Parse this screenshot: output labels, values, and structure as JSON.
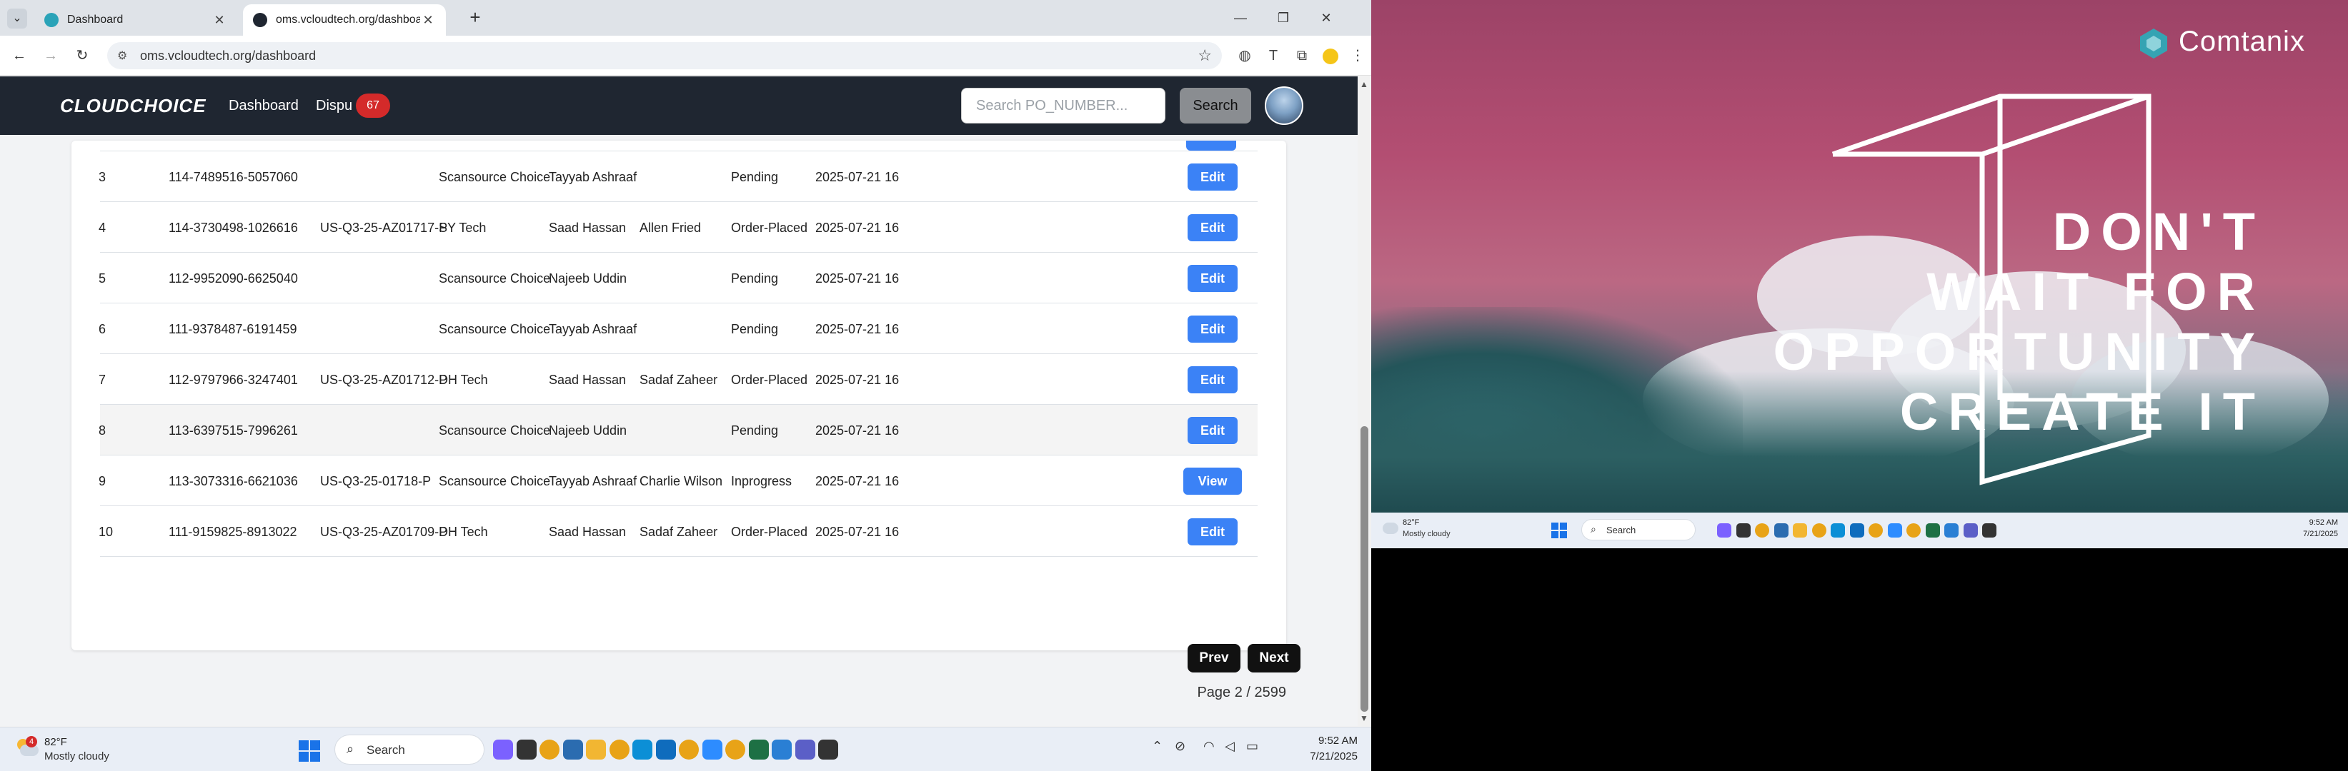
{
  "browser": {
    "tabs": [
      {
        "title": "Dashboard",
        "favicon_color": "#2aa3b8"
      },
      {
        "title": "oms.vcloudtech.org/dashboard",
        "favicon_color": "#1f2631"
      }
    ],
    "url": "oms.vcloudtech.org/dashboard"
  },
  "navbar": {
    "brand": "CLOUDCHOICE",
    "links": [
      "Dashboard",
      "Dispu"
    ],
    "badge": "67",
    "search_placeholder": "Search PO_NUMBER...",
    "search_label": "Search"
  },
  "table": {
    "rows": [
      {
        "n": "3",
        "order": "114-7489516-5057060",
        "ref": "",
        "supplier": "Scansource Choice",
        "agent": "Tayyab Ashraaf",
        "handler": "",
        "status": "Pending",
        "date": "2025-07-21 16",
        "action": "Edit"
      },
      {
        "n": "4",
        "order": "114-3730498-1026616",
        "ref": "US-Q3-25-AZ01717-P",
        "supplier": "SY Tech",
        "agent": "Saad Hassan",
        "handler": "Allen Fried",
        "status": "Order-Placed",
        "date": "2025-07-21 16",
        "action": "Edit"
      },
      {
        "n": "5",
        "order": "112-9952090-6625040",
        "ref": "",
        "supplier": "Scansource Choice",
        "agent": "Najeeb Uddin",
        "handler": "",
        "status": "Pending",
        "date": "2025-07-21 16",
        "action": "Edit"
      },
      {
        "n": "6",
        "order": "111-9378487-6191459",
        "ref": "",
        "supplier": "Scansource Choice",
        "agent": "Tayyab Ashraaf",
        "handler": "",
        "status": "Pending",
        "date": "2025-07-21 16",
        "action": "Edit"
      },
      {
        "n": "7",
        "order": "112-9797966-3247401",
        "ref": "US-Q3-25-AZ01712-P",
        "supplier": "DH Tech",
        "agent": "Saad Hassan",
        "handler": "Sadaf Zaheer",
        "status": "Order-Placed",
        "date": "2025-07-21 16",
        "action": "Edit"
      },
      {
        "n": "8",
        "order": "113-6397515-7996261",
        "ref": "",
        "supplier": "Scansource Choice",
        "agent": "Najeeb Uddin",
        "handler": "",
        "status": "Pending",
        "date": "2025-07-21 16",
        "action": "Edit"
      },
      {
        "n": "9",
        "order": "113-3073316-6621036",
        "ref": "US-Q3-25-01718-P",
        "supplier": "Scansource Choice",
        "agent": "Tayyab Ashraaf",
        "handler": "Charlie Wilson",
        "status": "Inprogress",
        "date": "2025-07-21 16",
        "action": "View"
      },
      {
        "n": "10",
        "order": "111-9159825-8913022",
        "ref": "US-Q3-25-AZ01709-P",
        "supplier": "DH Tech",
        "agent": "Saad Hassan",
        "handler": "Sadaf Zaheer",
        "status": "Order-Placed",
        "date": "2025-07-21 16",
        "action": "Edit"
      }
    ]
  },
  "pagination": {
    "prev": "Prev",
    "next": "Next",
    "info": "Page 2 / 2599"
  },
  "taskbar": {
    "temp": "82°F",
    "condition": "Mostly cloudy",
    "alert_count": "4",
    "search": "Search",
    "time": "9:52 AM",
    "date": "7/21/2025",
    "app_icons": [
      "widgets-icon",
      "file-explorer-icon",
      "chrome-icon",
      "calculator-icon",
      "folder-icon",
      "chrome-icon",
      "edge-icon",
      "outlook-icon",
      "chrome-icon",
      "zoom-icon",
      "chrome-icon",
      "excel-icon",
      "paint-icon",
      "teams-icon",
      "sticky-notes-icon"
    ]
  },
  "wallpaper": {
    "brand": "Comtanix",
    "slogan": [
      "DON'T",
      "WAIT FOR",
      "OPPORTUNITY",
      "CREATE IT"
    ]
  },
  "taskbar_right": {
    "temp": "82°F",
    "condition": "Mostly cloudy",
    "search": "Search",
    "time": "9:52 AM",
    "date": "7/21/2025"
  },
  "colors": {
    "accent": "#3b82f6",
    "navbar": "#1f2631",
    "badge": "#d42a2a",
    "wallpaper": "#b34e72"
  }
}
